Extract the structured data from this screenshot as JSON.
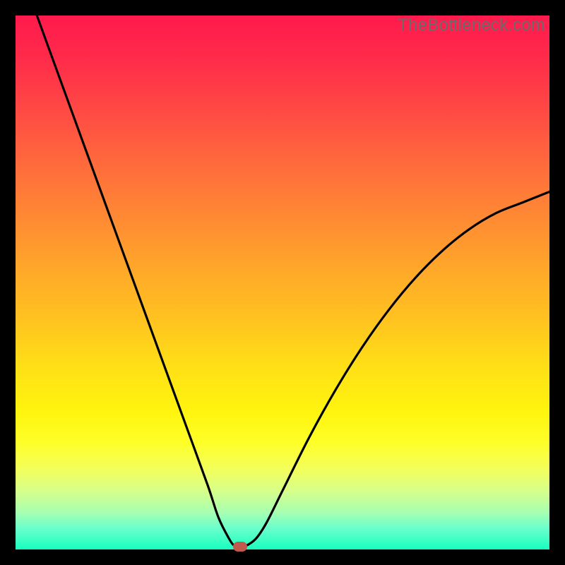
{
  "watermark": "TheBottleneck.com",
  "chart_data": {
    "type": "line",
    "title": "",
    "xlabel": "",
    "ylabel": "",
    "xlim": [
      0,
      100
    ],
    "ylim": [
      0,
      100
    ],
    "grid": false,
    "legend": false,
    "series": [
      {
        "name": "bottleneck-curve",
        "x": [
          4,
          8,
          12,
          16,
          20,
          24,
          28,
          32,
          36,
          38,
          40,
          41,
          42,
          43,
          45,
          47,
          50,
          55,
          60,
          65,
          70,
          75,
          80,
          85,
          90,
          95,
          100
        ],
        "y": [
          100,
          89,
          78,
          67,
          56,
          45,
          34,
          23,
          12,
          6,
          2,
          0.7,
          0.5,
          0.6,
          2,
          5,
          11,
          21,
          30,
          38,
          45,
          51,
          56,
          60,
          63,
          65,
          67
        ]
      }
    ],
    "marker": {
      "x": 42,
      "y": 0.5,
      "color": "#c1594e"
    },
    "background_gradient": {
      "top": "#ff1a4d",
      "mid": "#ffd21a",
      "bottom": "#18ffbf"
    }
  }
}
